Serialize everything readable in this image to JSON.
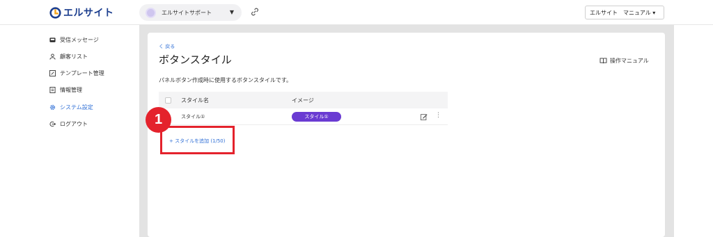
{
  "app": {
    "logo_text": "エルサイト",
    "brand_color": "#1d3f8f",
    "accent_color": "#2f6fd6"
  },
  "header": {
    "account_name": "エルサイトサポート",
    "account_dropdown_icon": "triangle-down-icon",
    "link_icon": "link-icon",
    "manual_dropdown": "エルサイト　マニュアル ▾"
  },
  "sidebar": {
    "items": [
      {
        "label": "受信メッセージ",
        "icon": "inbox-icon"
      },
      {
        "label": "顧客リスト",
        "icon": "user-icon"
      },
      {
        "label": "テンプレート管理",
        "icon": "edit-icon"
      },
      {
        "label": "情報管理",
        "icon": "document-icon"
      },
      {
        "label": "システム設定",
        "icon": "gear-icon",
        "active": true
      },
      {
        "label": "ログアウト",
        "icon": "logout-icon"
      }
    ]
  },
  "page": {
    "back_label": "く 戻る",
    "title": "ボタンスタイル",
    "operation_manual": "操作マニュアル",
    "description": "パネルボタン作成時に使用するボタンスタイルです。"
  },
  "table": {
    "columns": [
      "スタイル名",
      "イメージ"
    ],
    "rows": [
      {
        "name": "スタイル①",
        "preview_label": "スタイル①",
        "preview_color": "#6a3bd2"
      }
    ]
  },
  "add_style_label": "+ スタイルを追加 (1/50)",
  "annotation": {
    "step_number": "1",
    "highlight_color": "#e4222c"
  }
}
